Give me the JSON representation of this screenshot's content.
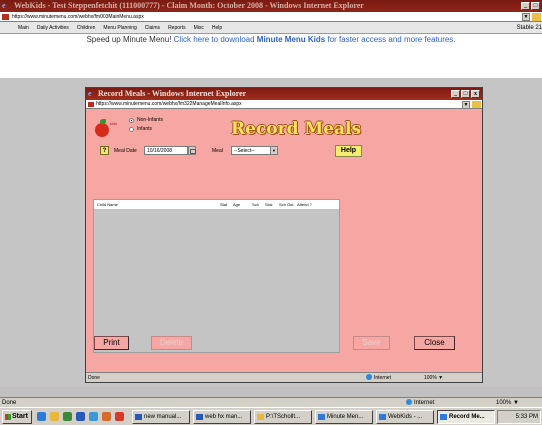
{
  "main_window": {
    "title": "WebKids - Test Steppenfetchit (111000777) - Claim Month: October 2008 - Windows Internet Explorer",
    "address": "https://www.minutemenu.com/webhx/fm003MainMenu.aspx",
    "menu": [
      "Main",
      "Daily Activities",
      "Children",
      "Menu Planning",
      "Claims",
      "Reports",
      "Misc",
      "Help"
    ],
    "stable_label": "Stable 21",
    "banner_text": "Speed up Minute Menu! ",
    "banner_link_prefix": "Click here to download ",
    "banner_link_bold": "Minute Menu Kids",
    "banner_link_suffix": " for faster access and more features."
  },
  "popup": {
    "title": "Record Meals - Windows Internet Explorer",
    "address": "https://www.minutemenu.com/webhx/fm322ManageMealInfo.aspx",
    "brand": "kids",
    "radio_non_infants": "Non-Infants",
    "radio_infants": "Infants",
    "heading": "Record Meals",
    "help_q": "?",
    "meal_date_label": "Meal Date",
    "meal_date_value": "10/16/2008",
    "meal_label": "Meal",
    "meal_select_value": "--Select--",
    "help_button": "Help",
    "grid_columns": [
      "Child Name",
      "Stat",
      "Age",
      "Sch",
      "Sick",
      "Sch Out",
      "Attend ?"
    ],
    "print_button": "Print",
    "delete_button": "Delete",
    "save_button": "Save",
    "close_button": "Close",
    "status_text": "Done",
    "status_zone": "Internet",
    "status_zoom": "100%"
  },
  "main_status": {
    "text": "Done",
    "zone": "Internet",
    "zoom": "100%"
  },
  "taskbar": {
    "start_label": "Start",
    "tasks": [
      "new manual...",
      "web hx man...",
      "P:\\TSchollt...",
      "Minute Men...",
      "WebKids - ...",
      "Record Me..."
    ],
    "clock": "5:33 PM"
  },
  "colors": {
    "titlebar": "#8f2418",
    "popup_body": "#f6a7a3",
    "heading": "#ffe25a",
    "help_button": "#f3ec6c",
    "link": "#2f61c8"
  }
}
